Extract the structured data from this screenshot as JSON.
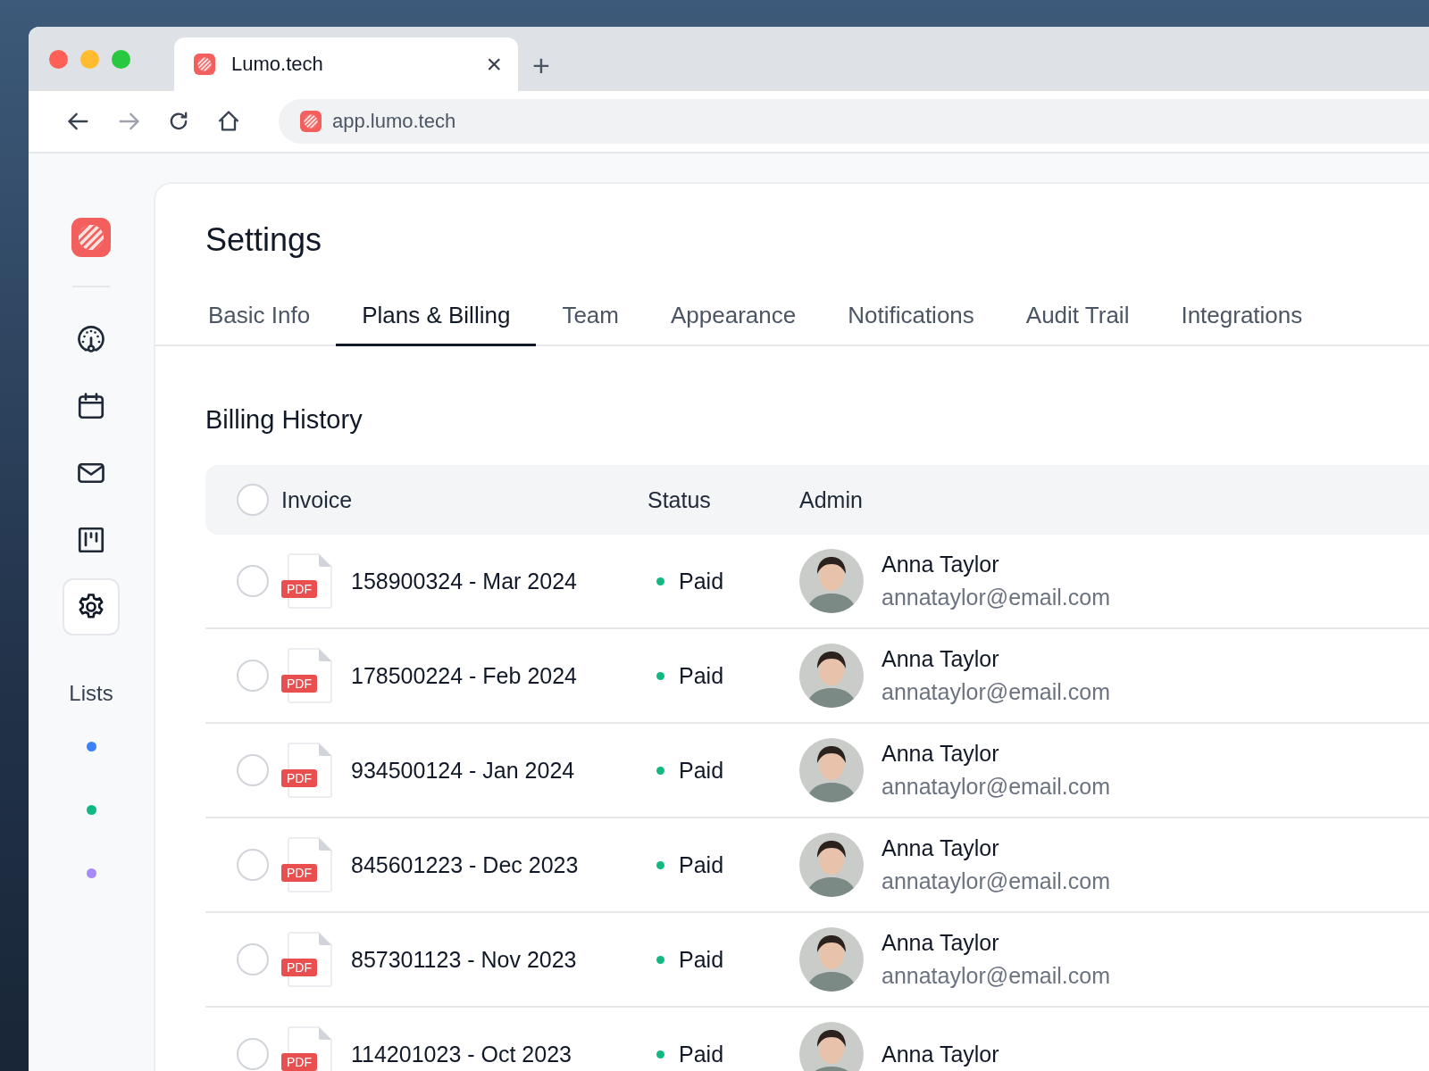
{
  "browser": {
    "tab": {
      "title": "Lumo.tech",
      "close": "×"
    },
    "new_tab": "+",
    "address": "app.lumo.tech"
  },
  "sidebar": {
    "nav": [
      {
        "kind": "gauge",
        "selected": false
      },
      {
        "kind": "calendar",
        "selected": false
      },
      {
        "kind": "mail",
        "selected": false
      },
      {
        "kind": "board",
        "selected": false
      },
      {
        "kind": "gear",
        "selected": true
      }
    ],
    "lists_label": "Lists",
    "lists": [
      {
        "color": "#3b82f6"
      },
      {
        "color": "#10b981"
      },
      {
        "color": "#a78bfa"
      }
    ]
  },
  "page": {
    "title": "Settings"
  },
  "tabs": [
    {
      "label": "Basic Info",
      "selected": false
    },
    {
      "label": "Plans & Billing",
      "selected": true
    },
    {
      "label": "Team",
      "selected": false
    },
    {
      "label": "Appearance",
      "selected": false
    },
    {
      "label": "Notifications",
      "selected": false
    },
    {
      "label": "Audit Trail",
      "selected": false
    },
    {
      "label": "Integrations",
      "selected": false
    }
  ],
  "billing": {
    "title": "Billing History",
    "header": {
      "checked": false,
      "columns": [
        "Invoice",
        "Status",
        "Admin"
      ]
    },
    "rows": [
      {
        "checked": false,
        "file_badge": "PDF",
        "invoice": "158900324 - Mar 2024",
        "status": "Paid",
        "admin_name": "Anna Taylor",
        "admin_email": "annataylor@email.com"
      },
      {
        "checked": false,
        "file_badge": "PDF",
        "invoice": "178500224 - Feb 2024",
        "status": "Paid",
        "admin_name": "Anna Taylor",
        "admin_email": "annataylor@email.com"
      },
      {
        "checked": false,
        "file_badge": "PDF",
        "invoice": "934500124 - Jan 2024",
        "status": "Paid",
        "admin_name": "Anna Taylor",
        "admin_email": "annataylor@email.com"
      },
      {
        "checked": false,
        "file_badge": "PDF",
        "invoice": "845601223 - Dec 2023",
        "status": "Paid",
        "admin_name": "Anna Taylor",
        "admin_email": "annataylor@email.com"
      },
      {
        "checked": false,
        "file_badge": "PDF",
        "invoice": "857301123 - Nov 2023",
        "status": "Paid",
        "admin_name": "Anna Taylor",
        "admin_email": "annataylor@email.com"
      },
      {
        "checked": false,
        "file_badge": "PDF",
        "invoice": "114201023 - Oct 2023",
        "status": "Paid",
        "admin_name": "Anna Taylor"
      }
    ]
  }
}
